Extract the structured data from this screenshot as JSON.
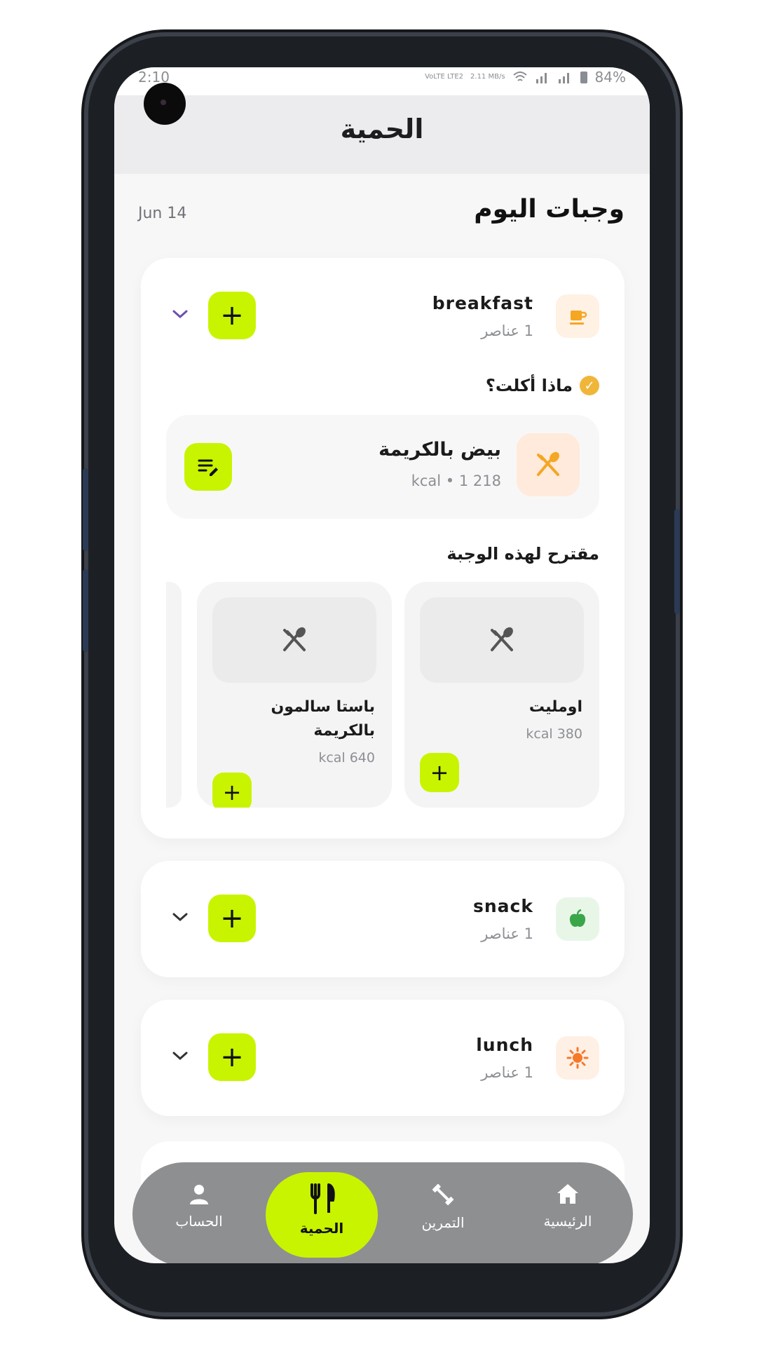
{
  "status_bar": {
    "time": "2:10",
    "net1": "VoLTE LTE2",
    "net2": "2.11 MB/s",
    "battery": "84%"
  },
  "header": {
    "title": "الحمية"
  },
  "section": {
    "title": "وجبات اليوم",
    "date": "Jun 14"
  },
  "meals": [
    {
      "name": "breakfast",
      "count": "1 عناصر",
      "icon": "coffee-icon",
      "icon_bg": "#fff1e3",
      "icon_color": "#f5a623",
      "expanded": true,
      "ate_label": "ماذا أكلت؟",
      "items": [
        {
          "name": "بيض بالكريمة",
          "kcal": "kcal • 1 218"
        }
      ],
      "suggest_title": "مقترح لهذه الوجبة",
      "suggestions": [
        {
          "name": "اومليت",
          "kcal": "kcal 380"
        },
        {
          "name": "باستا سالمون بالكريمة",
          "kcal": "kcal 640"
        }
      ]
    },
    {
      "name": "snack",
      "count": "1 عناصر",
      "icon": "apple-icon",
      "icon_bg": "#e8f6e8",
      "icon_color": "#3aa64a"
    },
    {
      "name": "lunch",
      "count": "1 عناصر",
      "icon": "sun-icon",
      "icon_bg": "#fff0e6",
      "icon_color": "#f47a2a"
    }
  ],
  "nav": [
    {
      "label": "الحساب",
      "icon": "person-icon"
    },
    {
      "label": "الحمية",
      "icon": "fork-knife-icon",
      "active": true
    },
    {
      "label": "التمرين",
      "icon": "dumbbell-icon"
    },
    {
      "label": "الرئيسية",
      "icon": "home-icon"
    }
  ],
  "colors": {
    "accent": "#c8f400",
    "background": "#f7f7f7",
    "nav_bg": "#8e8f91"
  }
}
